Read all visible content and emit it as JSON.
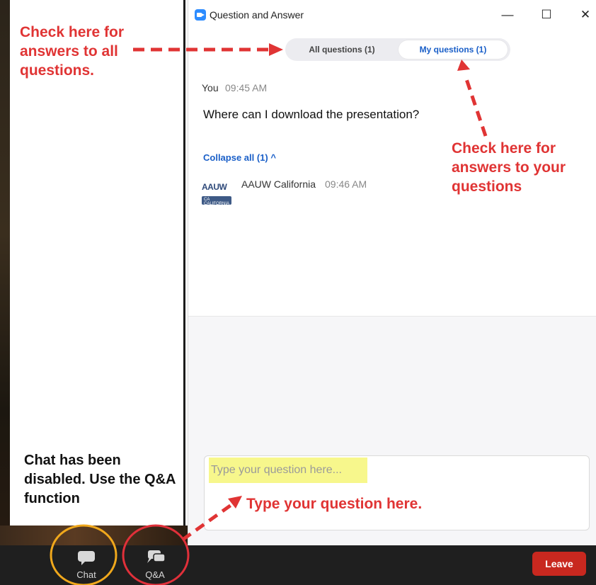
{
  "window": {
    "title": "Question and Answer",
    "minimize_glyph": "—",
    "maximize_glyph": "☐",
    "close_glyph": "✕"
  },
  "tabs": [
    {
      "label": "All questions (1)",
      "selected": false
    },
    {
      "label": "My questions (1)",
      "selected": true
    }
  ],
  "question": {
    "author": "You",
    "time": "09:45 AM",
    "text": "Where can I download the presentation?"
  },
  "collapse_label": "Collapse all (1) ^",
  "answer": {
    "avatar_text": "AAUW",
    "avatar_sub": "CA CALIFORNIA",
    "author": "AAUW California",
    "time": "09:46 AM"
  },
  "input": {
    "placeholder": "Type your question here..."
  },
  "toolbar": {
    "chat_label": "Chat",
    "qa_label": "Q&A",
    "leave_label": "Leave"
  },
  "annotations": {
    "all_questions": "Check here for answers to all questions.",
    "your_questions": "Check here for answers to your questions",
    "type_question": "Type your question here.",
    "chat_disabled": "Chat has been disabled. Use the Q&A function"
  },
  "colors": {
    "annotation_red": "#e03434",
    "highlight_yellow": "#f7f78c",
    "chat_circle": "#f0a81c",
    "qa_circle": "#e0303a",
    "leave_red": "#c8281f",
    "tab_selected_blue": "#1a5fc8"
  },
  "icons": [
    "app-icon",
    "chat-icon",
    "qa-icon",
    "chevron-up-icon",
    "minimize-icon",
    "maximize-icon",
    "close-icon"
  ]
}
